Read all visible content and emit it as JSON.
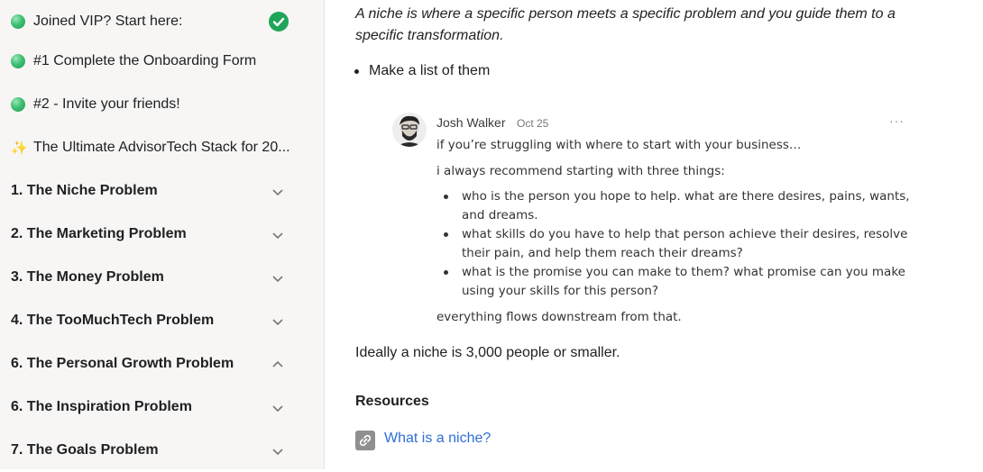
{
  "sidebar": {
    "items": [
      {
        "label": "Joined VIP? Start here:",
        "icon": "green-dot-icon",
        "completed": true
      },
      {
        "label": "#1 Complete the Onboarding Form",
        "icon": "green-dot-icon"
      },
      {
        "label": "#2 - Invite your friends!",
        "icon": "green-dot-icon"
      },
      {
        "label": "The Ultimate AdvisorTech Stack for 20...",
        "icon": "sparkles-icon"
      }
    ],
    "sections": [
      {
        "label": "1. The Niche Problem",
        "expanded": false
      },
      {
        "label": "2. The Marketing Problem",
        "expanded": false
      },
      {
        "label": "3. The Money Problem",
        "expanded": false
      },
      {
        "label": "4. The TooMuchTech Problem",
        "expanded": false
      },
      {
        "label": "6. The Personal Growth Problem",
        "expanded": true
      },
      {
        "label": "6. The Inspiration Problem",
        "expanded": false
      },
      {
        "label": "7. The Goals Problem",
        "expanded": false
      }
    ]
  },
  "content": {
    "quote": "A niche is where a specific person meets a specific problem and you guide them to a specific transformation.",
    "bullet": "Make a list of them",
    "comment": {
      "author": "Josh Walker",
      "date": "Oct 25",
      "line1": "if you’re struggling with where to start with your business…",
      "line2": "i always recommend starting with three things:",
      "bullets": [
        "who is the person you hope to help. what are there desires, pains, wants, and dreams.",
        "what skills do you have to help that person achieve their desires, resolve their pain, and help them reach their dreams?",
        "what is the promise you can make to them? what promise can you make using your skills for this person?"
      ],
      "closing": "everything flows downstream from that."
    },
    "paragraph": "Ideally a niche is 3,000 people or smaller.",
    "resources_title": "Resources",
    "resource_link": "What is a niche?"
  },
  "colors": {
    "sidebar_bg": "#f7f6f4",
    "complete_green": "#1fa55a",
    "link_blue": "#2f6fd6"
  }
}
